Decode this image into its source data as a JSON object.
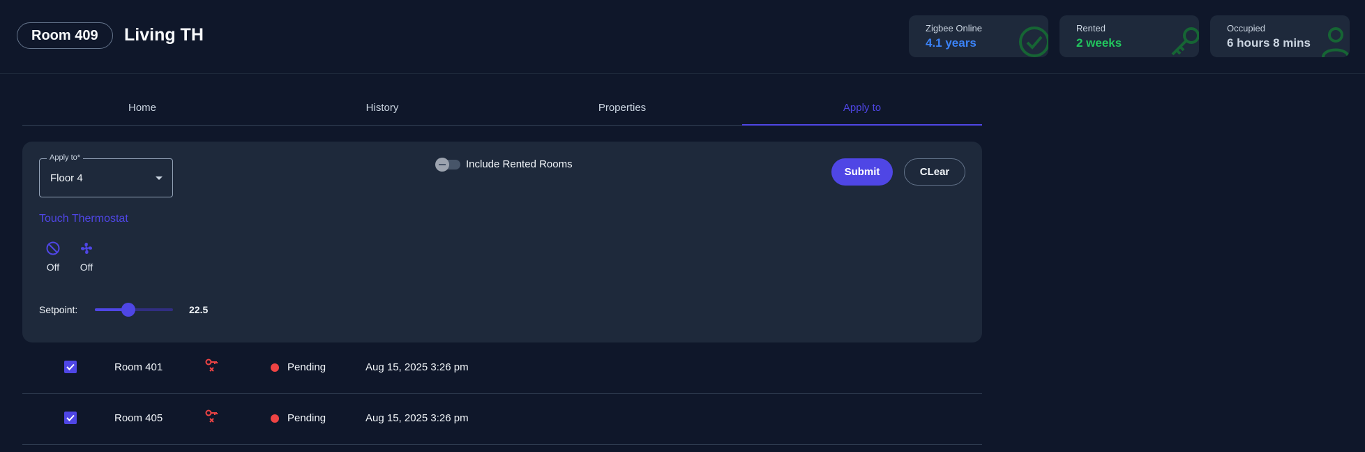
{
  "header": {
    "room_label": "Room 409",
    "title": "Living TH",
    "stats": [
      {
        "label": "Zigbee Online",
        "value": "4.1 years",
        "color": "#3b82f6",
        "icon": "check-circle-icon"
      },
      {
        "label": "Rented",
        "value": "2 weeks",
        "color": "#22c55e",
        "icon": "key-icon"
      },
      {
        "label": "Occupied",
        "value": "6 hours 8 mins",
        "color": "#cbd5e1",
        "icon": "person-icon"
      }
    ]
  },
  "tabs": [
    {
      "label": "Home",
      "active": false
    },
    {
      "label": "History",
      "active": false
    },
    {
      "label": "Properties",
      "active": false
    },
    {
      "label": "Apply to",
      "active": true
    }
  ],
  "panel": {
    "apply_to": {
      "legend": "Apply to*",
      "value": "Floor 4"
    },
    "include_rented": {
      "label": "Include Rented Rooms",
      "checked": false
    },
    "submit_label": "Submit",
    "clear_label": "CLear",
    "section_title": "Touch Thermostat",
    "modes": [
      {
        "icon": "block-icon",
        "label": "Off"
      },
      {
        "icon": "fan-icon",
        "label": "Off"
      }
    ],
    "setpoint": {
      "label": "Setpoint:",
      "value": "22.5",
      "fraction": 0.43
    }
  },
  "rows": [
    {
      "room": "Room 401",
      "status": "Pending",
      "time": "Aug 15, 2025 3:26 pm",
      "checked": true,
      "icon": "key-off-icon"
    },
    {
      "room": "Room 405",
      "status": "Pending",
      "time": "Aug 15, 2025 3:26 pm",
      "checked": true,
      "icon": "key-off-icon"
    }
  ],
  "colors": {
    "accent": "#4f46e5",
    "status_pending": "#ef4444",
    "key_off": "#ef4444"
  }
}
